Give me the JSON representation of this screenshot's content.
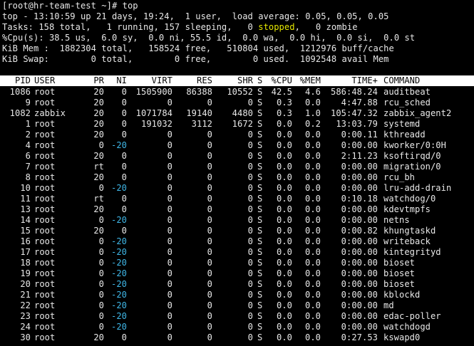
{
  "prompt": {
    "text": "[root@hr-team-test ~]# top"
  },
  "summary": {
    "line1": "top - 13:10:59 up 21 days, 19:24,  1 user,  load average: 0.05, 0.05, 0.05",
    "line2_pre": "Tasks: 158 total,   1 running, 157 sleeping,   0 ",
    "line2_stopped": "stopped",
    "line2_post": ",   0 zombie",
    "line3": "%Cpu(s): 38.5 us,  6.0 sy,  0.0 ni, 55.5 id,  0.0 wa,  0.0 hi,  0.0 si,  0.0 st",
    "line4": "KiB Mem :  1882304 total,   158524 free,   510804 used,  1212976 buff/cache",
    "line5": "KiB Swap:        0 total,        0 free,        0 used.  1092548 avail Mem"
  },
  "columns": [
    "PID",
    "USER",
    "PR",
    "NI",
    "VIRT",
    "RES",
    "SHR",
    "S",
    "%CPU",
    "%MEM",
    "TIME+",
    "COMMAND"
  ],
  "processes": [
    {
      "pid": "1086",
      "user": "root",
      "pr": "20",
      "ni": "0",
      "virt": "1505900",
      "res": "86388",
      "shr": "10552",
      "s": "S",
      "cpu": "42.5",
      "mem": "4.6",
      "time": "586:48.24",
      "command": "auditbeat"
    },
    {
      "pid": "9",
      "user": "root",
      "pr": "20",
      "ni": "0",
      "virt": "0",
      "res": "0",
      "shr": "0",
      "s": "S",
      "cpu": "0.3",
      "mem": "0.0",
      "time": "4:47.88",
      "command": "rcu_sched"
    },
    {
      "pid": "1082",
      "user": "zabbix",
      "pr": "20",
      "ni": "0",
      "virt": "1071784",
      "res": "19140",
      "shr": "4480",
      "s": "S",
      "cpu": "0.3",
      "mem": "1.0",
      "time": "105:47.32",
      "command": "zabbix_agent2"
    },
    {
      "pid": "1",
      "user": "root",
      "pr": "20",
      "ni": "0",
      "virt": "191032",
      "res": "3112",
      "shr": "1672",
      "s": "S",
      "cpu": "0.0",
      "mem": "0.2",
      "time": "13:03.79",
      "command": "systemd"
    },
    {
      "pid": "2",
      "user": "root",
      "pr": "20",
      "ni": "0",
      "virt": "0",
      "res": "0",
      "shr": "0",
      "s": "S",
      "cpu": "0.0",
      "mem": "0.0",
      "time": "0:00.11",
      "command": "kthreadd"
    },
    {
      "pid": "4",
      "user": "root",
      "pr": "0",
      "ni": "-20",
      "virt": "0",
      "res": "0",
      "shr": "0",
      "s": "S",
      "cpu": "0.0",
      "mem": "0.0",
      "time": "0:00.00",
      "command": "kworker/0:0H"
    },
    {
      "pid": "6",
      "user": "root",
      "pr": "20",
      "ni": "0",
      "virt": "0",
      "res": "0",
      "shr": "0",
      "s": "S",
      "cpu": "0.0",
      "mem": "0.0",
      "time": "2:11.23",
      "command": "ksoftirqd/0"
    },
    {
      "pid": "7",
      "user": "root",
      "pr": "rt",
      "ni": "0",
      "virt": "0",
      "res": "0",
      "shr": "0",
      "s": "S",
      "cpu": "0.0",
      "mem": "0.0",
      "time": "0:00.00",
      "command": "migration/0"
    },
    {
      "pid": "8",
      "user": "root",
      "pr": "20",
      "ni": "0",
      "virt": "0",
      "res": "0",
      "shr": "0",
      "s": "S",
      "cpu": "0.0",
      "mem": "0.0",
      "time": "0:00.00",
      "command": "rcu_bh"
    },
    {
      "pid": "10",
      "user": "root",
      "pr": "0",
      "ni": "-20",
      "virt": "0",
      "res": "0",
      "shr": "0",
      "s": "S",
      "cpu": "0.0",
      "mem": "0.0",
      "time": "0:00.00",
      "command": "lru-add-drain"
    },
    {
      "pid": "11",
      "user": "root",
      "pr": "rt",
      "ni": "0",
      "virt": "0",
      "res": "0",
      "shr": "0",
      "s": "S",
      "cpu": "0.0",
      "mem": "0.0",
      "time": "0:10.18",
      "command": "watchdog/0"
    },
    {
      "pid": "13",
      "user": "root",
      "pr": "20",
      "ni": "0",
      "virt": "0",
      "res": "0",
      "shr": "0",
      "s": "S",
      "cpu": "0.0",
      "mem": "0.0",
      "time": "0:00.00",
      "command": "kdevtmpfs"
    },
    {
      "pid": "14",
      "user": "root",
      "pr": "0",
      "ni": "-20",
      "virt": "0",
      "res": "0",
      "shr": "0",
      "s": "S",
      "cpu": "0.0",
      "mem": "0.0",
      "time": "0:00.00",
      "command": "netns"
    },
    {
      "pid": "15",
      "user": "root",
      "pr": "20",
      "ni": "0",
      "virt": "0",
      "res": "0",
      "shr": "0",
      "s": "S",
      "cpu": "0.0",
      "mem": "0.0",
      "time": "0:00.82",
      "command": "khungtaskd"
    },
    {
      "pid": "16",
      "user": "root",
      "pr": "0",
      "ni": "-20",
      "virt": "0",
      "res": "0",
      "shr": "0",
      "s": "S",
      "cpu": "0.0",
      "mem": "0.0",
      "time": "0:00.00",
      "command": "writeback"
    },
    {
      "pid": "17",
      "user": "root",
      "pr": "0",
      "ni": "-20",
      "virt": "0",
      "res": "0",
      "shr": "0",
      "s": "S",
      "cpu": "0.0",
      "mem": "0.0",
      "time": "0:00.00",
      "command": "kintegrityd"
    },
    {
      "pid": "18",
      "user": "root",
      "pr": "0",
      "ni": "-20",
      "virt": "0",
      "res": "0",
      "shr": "0",
      "s": "S",
      "cpu": "0.0",
      "mem": "0.0",
      "time": "0:00.00",
      "command": "bioset"
    },
    {
      "pid": "19",
      "user": "root",
      "pr": "0",
      "ni": "-20",
      "virt": "0",
      "res": "0",
      "shr": "0",
      "s": "S",
      "cpu": "0.0",
      "mem": "0.0",
      "time": "0:00.00",
      "command": "bioset"
    },
    {
      "pid": "20",
      "user": "root",
      "pr": "0",
      "ni": "-20",
      "virt": "0",
      "res": "0",
      "shr": "0",
      "s": "S",
      "cpu": "0.0",
      "mem": "0.0",
      "time": "0:00.00",
      "command": "bioset"
    },
    {
      "pid": "21",
      "user": "root",
      "pr": "0",
      "ni": "-20",
      "virt": "0",
      "res": "0",
      "shr": "0",
      "s": "S",
      "cpu": "0.0",
      "mem": "0.0",
      "time": "0:00.00",
      "command": "kblockd"
    },
    {
      "pid": "22",
      "user": "root",
      "pr": "0",
      "ni": "-20",
      "virt": "0",
      "res": "0",
      "shr": "0",
      "s": "S",
      "cpu": "0.0",
      "mem": "0.0",
      "time": "0:00.00",
      "command": "md"
    },
    {
      "pid": "23",
      "user": "root",
      "pr": "0",
      "ni": "-20",
      "virt": "0",
      "res": "0",
      "shr": "0",
      "s": "S",
      "cpu": "0.0",
      "mem": "0.0",
      "time": "0:00.00",
      "command": "edac-poller"
    },
    {
      "pid": "24",
      "user": "root",
      "pr": "0",
      "ni": "-20",
      "virt": "0",
      "res": "0",
      "shr": "0",
      "s": "S",
      "cpu": "0.0",
      "mem": "0.0",
      "time": "0:00.00",
      "command": "watchdogd"
    },
    {
      "pid": "30",
      "user": "root",
      "pr": "20",
      "ni": "0",
      "virt": "0",
      "res": "0",
      "shr": "0",
      "s": "S",
      "cpu": "0.0",
      "mem": "0.0",
      "time": "0:27.53",
      "command": "kswapd0"
    }
  ],
  "colors": {
    "background": "#000000",
    "foreground": "#e8e8e8",
    "header_bg": "#ffffff",
    "stopped": "#e5e800",
    "negative_nice": "#3fb6e6"
  }
}
